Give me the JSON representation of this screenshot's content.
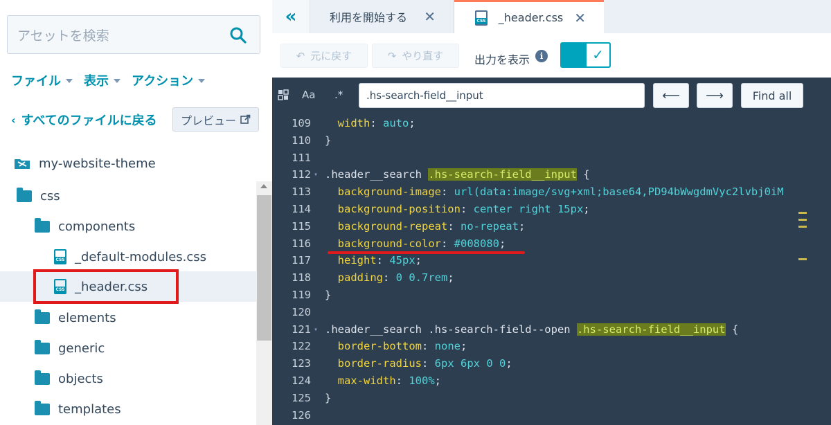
{
  "sidebar": {
    "search_placeholder": "アセットを検索",
    "menus": [
      "ファイル",
      "表示",
      "アクション"
    ],
    "back_link": "すべてのファイルに戻る",
    "preview_button": "プレビュー",
    "tree": [
      {
        "label": "my-website-theme",
        "kind": "theme"
      },
      {
        "label": "css",
        "kind": "folder-open"
      },
      {
        "label": "components",
        "kind": "folder-open"
      },
      {
        "label": "_default-modules.css",
        "kind": "css-file"
      },
      {
        "label": "_header.css",
        "kind": "css-file",
        "selected": true
      },
      {
        "label": "elements",
        "kind": "folder"
      },
      {
        "label": "generic",
        "kind": "folder"
      },
      {
        "label": "objects",
        "kind": "folder"
      },
      {
        "label": "templates",
        "kind": "folder"
      }
    ]
  },
  "tabs": [
    {
      "label": "利用を開始する"
    },
    {
      "label": "_header.css",
      "active": true
    }
  ],
  "toolbar": {
    "undo": "元に戻す",
    "redo": "やり直す",
    "output_label": "出力を表示",
    "output_enabled": true
  },
  "find": {
    "case_option": "Aa",
    "regex_option": ".*",
    "query": ".hs-search-field__input",
    "find_all": "Find all"
  },
  "code": {
    "lines": [
      {
        "n": "109",
        "text": "  width: auto;"
      },
      {
        "n": "110",
        "text": "}"
      },
      {
        "n": "111",
        "text": ""
      },
      {
        "n": "112",
        "text": ".header__search .hs-search-field__input {"
      },
      {
        "n": "113",
        "text": "  background-image: url(data:image/svg+xml;base64,PD94bWwgdmVyc2lvbj0iM"
      },
      {
        "n": "114",
        "text": "  background-position: center right 15px;"
      },
      {
        "n": "115",
        "text": "  background-repeat: no-repeat;"
      },
      {
        "n": "116",
        "text": "  background-color: #008080;"
      },
      {
        "n": "117",
        "text": "  height: 45px;"
      },
      {
        "n": "118",
        "text": "  padding: 0 0.7rem;"
      },
      {
        "n": "119",
        "text": "}"
      },
      {
        "n": "120",
        "text": ""
      },
      {
        "n": "121",
        "text": ".header__search .hs-search-field--open .hs-search-field__input {"
      },
      {
        "n": "122",
        "text": "  border-bottom: none;"
      },
      {
        "n": "123",
        "text": "  border-radius: 6px 6px 0 0;"
      },
      {
        "n": "124",
        "text": "  max-width: 100%;"
      },
      {
        "n": "125",
        "text": "}"
      },
      {
        "n": "126",
        "text": ""
      }
    ]
  },
  "colors": {
    "accent": "#0091ae",
    "editor_bg": "#2d3e50",
    "annotation_red": "#e01a1a",
    "property": "#f2d53c",
    "value": "#51d3d9",
    "match_highlight": "#6b7c1e"
  },
  "icons": {
    "search": "search-icon",
    "caret": "chevron-down-icon",
    "back": "chevron-left-icon",
    "external": "external-link-icon",
    "collapse": "double-chevron-left-icon",
    "close": "close-icon",
    "css_file": "css-file-icon",
    "folder": "folder-icon",
    "info": "info-icon",
    "check": "check-icon",
    "arrow_left": "arrow-left-icon",
    "arrow_right": "arrow-right-icon"
  }
}
